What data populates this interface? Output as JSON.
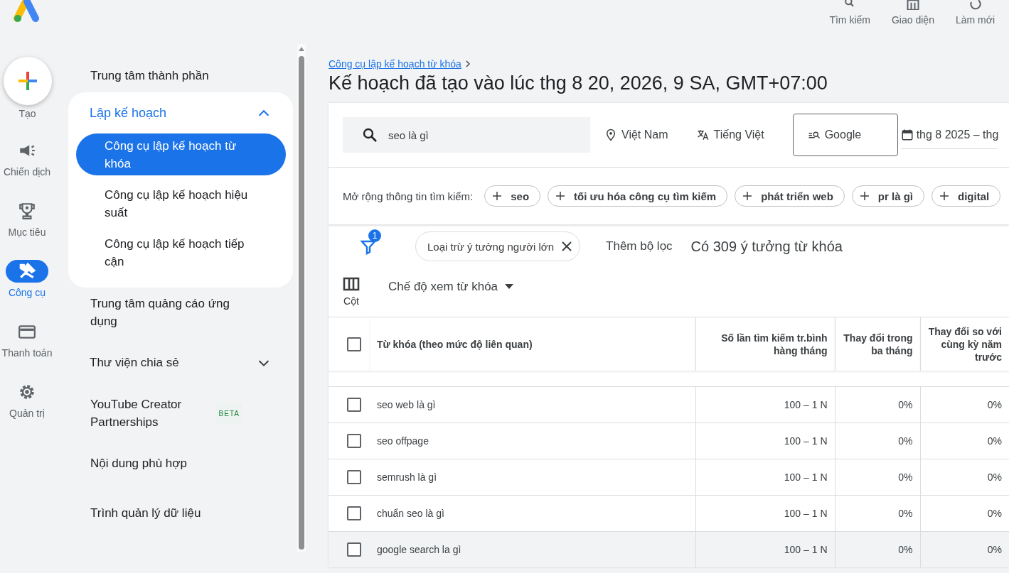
{
  "toolbar": [
    {
      "label": "Tìm kiếm",
      "kind": "search"
    },
    {
      "label": "Giao diện",
      "kind": "appearance"
    },
    {
      "label": "Làm mới",
      "kind": "refresh"
    }
  ],
  "rail": {
    "create_label": "Tạo",
    "items": [
      {
        "label": "Chiến dịch",
        "kind": "campaign",
        "selected": false
      },
      {
        "label": "Mục tiêu",
        "kind": "goals",
        "selected": false
      },
      {
        "label": "Công cụ",
        "kind": "tools",
        "selected": true
      },
      {
        "label": "Thanh toán",
        "kind": "billing",
        "selected": false
      },
      {
        "label": "Quản trị",
        "kind": "admin",
        "selected": false
      }
    ]
  },
  "nav": [
    {
      "kind": "link",
      "label": "Trung tâm thành phần"
    },
    {
      "kind": "group",
      "label": "Lập kế hoạch",
      "expanded": true,
      "children": [
        {
          "label": "Công cụ lập kế hoạch từ khóa",
          "selected": true
        },
        {
          "label": "Công cụ lập kế hoạch hiệu suất",
          "selected": false
        },
        {
          "label": "Công cụ lập kế hoạch tiếp cận",
          "selected": false
        }
      ]
    },
    {
      "kind": "link",
      "label": "Trung tâm quảng cáo ứng dụng"
    },
    {
      "kind": "group",
      "label": "Thư viện chia sẻ",
      "expanded": false
    },
    {
      "kind": "link",
      "label": "YouTube Creator Partnerships",
      "badge": "BETA"
    },
    {
      "kind": "link",
      "label": "Nội dung phù hợp"
    },
    {
      "kind": "link",
      "label": "Trình quản lý dữ liệu"
    }
  ],
  "breadcrumb": "Công cụ lập kế hoạch từ khóa",
  "title": "Kế hoạch đã tạo vào lúc thg 8 20, 2026, 9 SA, GMT+07:00",
  "search": {
    "value": "seo là gì"
  },
  "location": "Việt Nam",
  "language": "Tiếng Việt",
  "network": "Google",
  "date_range": "thg 8 2025 – thg",
  "refine": {
    "label": "Mở rộng thông tin tìm kiếm:",
    "chips": [
      "seo",
      "tối ưu hóa công cụ tìm kiếm",
      "phát triển web",
      "pr là gì",
      "digital"
    ]
  },
  "filters": {
    "count": "1",
    "chips": [
      "Loại trừ ý tưởng người lớn"
    ],
    "add_filter": "Thêm bộ lọc",
    "summary": "Có 309 ý tưởng từ khóa"
  },
  "columns_button": "Cột",
  "view_selector": "Chế độ xem từ khóa",
  "table": {
    "header_checked": false,
    "columns": [
      "Từ khóa (theo mức độ liên quan)",
      "Số lần tìm kiếm tr.bình hàng tháng",
      "Thay đổi trong ba tháng",
      "Thay đổi so với cùng kỳ năm trước"
    ],
    "rows": [
      {
        "checked": false,
        "highlighted": false,
        "cells": [
          "seo web là gì",
          "100 – 1 N",
          "0%",
          "0%"
        ]
      },
      {
        "checked": false,
        "highlighted": false,
        "cells": [
          "seo offpage",
          "100 – 1 N",
          "0%",
          "0%"
        ]
      },
      {
        "checked": false,
        "highlighted": false,
        "cells": [
          "semrush là gì",
          "100 – 1 N",
          "0%",
          "0%"
        ]
      },
      {
        "checked": false,
        "highlighted": false,
        "cells": [
          "chuẩn seo là gì",
          "100 – 1 N",
          "0%",
          "0%"
        ]
      },
      {
        "checked": false,
        "highlighted": true,
        "cells": [
          "google search la gì",
          "100 – 1 N",
          "0%",
          "0%"
        ]
      }
    ]
  }
}
